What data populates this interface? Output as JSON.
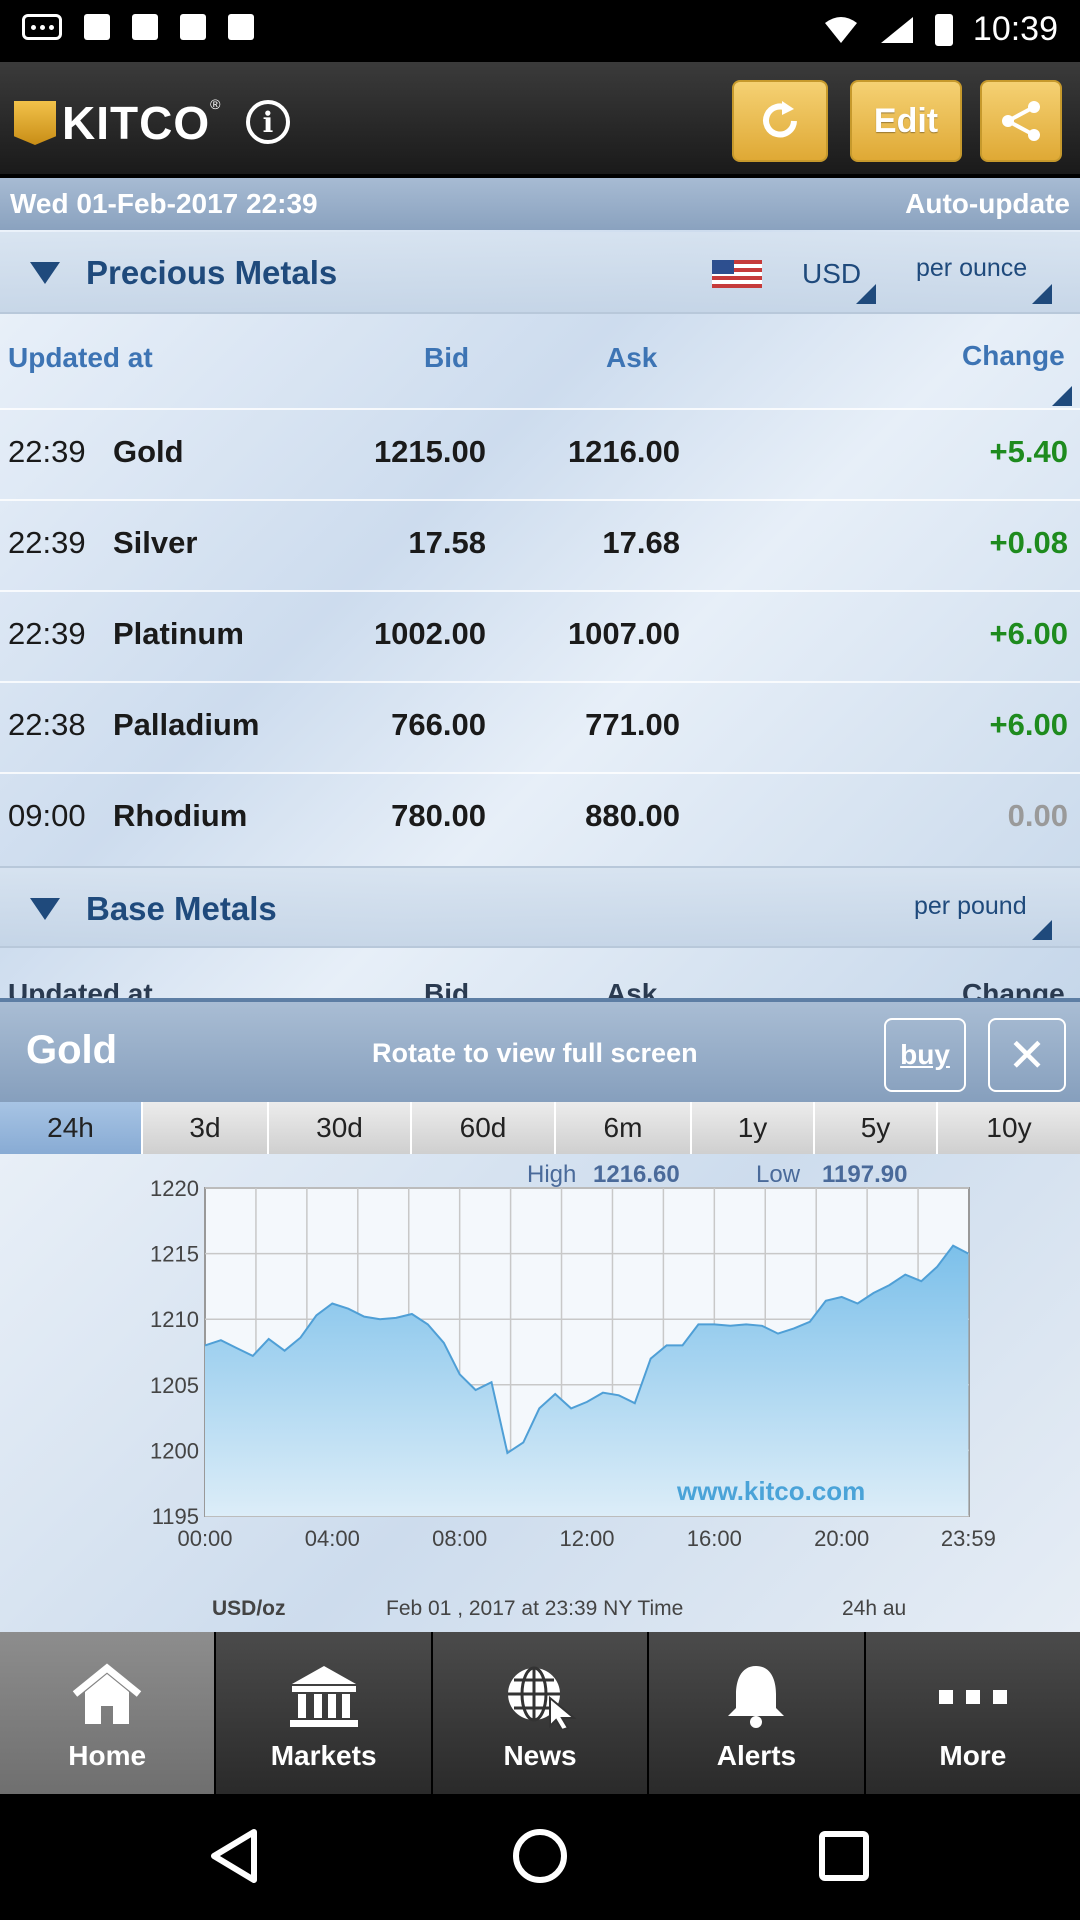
{
  "status_bar": {
    "time": "10:39"
  },
  "header": {
    "logo_text": "KITCO",
    "logo_reg": "®",
    "edit_label": "Edit"
  },
  "date_bar": {
    "date": "Wed 01-Feb-2017 22:39",
    "auto_update": "Auto-update"
  },
  "precious": {
    "title": "Precious Metals",
    "currency": "USD",
    "unit": "per ounce",
    "columns": {
      "updated": "Updated at",
      "bid": "Bid",
      "ask": "Ask",
      "change": "Change"
    },
    "rows": [
      {
        "time": "22:39",
        "name": "Gold",
        "bid": "1215.00",
        "ask": "1216.00",
        "change": "+5.40"
      },
      {
        "time": "22:39",
        "name": "Silver",
        "bid": "17.58",
        "ask": "17.68",
        "change": "+0.08"
      },
      {
        "time": "22:39",
        "name": "Platinum",
        "bid": "1002.00",
        "ask": "1007.00",
        "change": "+6.00"
      },
      {
        "time": "22:38",
        "name": "Palladium",
        "bid": "766.00",
        "ask": "771.00",
        "change": "+6.00"
      },
      {
        "time": "09:00",
        "name": "Rhodium",
        "bid": "780.00",
        "ask": "880.00",
        "change": "0.00"
      }
    ]
  },
  "base": {
    "title": "Base Metals",
    "unit": "per pound",
    "columns": {
      "updated": "Updated at",
      "bid": "Bid",
      "ask": "Ask",
      "change": "Change"
    }
  },
  "chart_panel": {
    "title": "Gold",
    "rotate_hint": "Rotate to view full screen",
    "buy_label": "buy",
    "close_label": "✕",
    "tabs": [
      "24h",
      "3d",
      "30d",
      "60d",
      "6m",
      "1y",
      "5y",
      "10y"
    ],
    "active_tab": "24h"
  },
  "chart_data": {
    "type": "area",
    "high_label": "High",
    "high_value": "1216.60",
    "low_label": "Low",
    "low_value": "1197.90",
    "watermark": "www.kitco.com",
    "unit_label": "USD/oz",
    "footnote": "Feb 01 , 2017 at 23:39 NY Time",
    "range_label": "24h au",
    "ylim": [
      1195,
      1220
    ],
    "yticks": [
      1220,
      1215,
      1210,
      1205,
      1200,
      1195
    ],
    "xticks": [
      "00:00",
      "04:00",
      "08:00",
      "12:00",
      "16:00",
      "20:00",
      "23:59"
    ],
    "x_hours": [
      0,
      0.5,
      1,
      1.5,
      2,
      2.5,
      3,
      3.5,
      4,
      4.5,
      5,
      5.5,
      6,
      6.5,
      7,
      7.5,
      8,
      8.5,
      9,
      9.5,
      10,
      10.5,
      11,
      11.5,
      12,
      12.5,
      13,
      13.5,
      14,
      14.5,
      15,
      15.5,
      16,
      16.5,
      17,
      17.5,
      18,
      18.5,
      19,
      19.5,
      20,
      20.5,
      21,
      21.5,
      22,
      22.5,
      23,
      23.5,
      23.98
    ],
    "values": [
      1208.0,
      1208.4,
      1207.8,
      1207.2,
      1208.5,
      1207.6,
      1208.6,
      1210.3,
      1211.2,
      1210.8,
      1210.2,
      1210.0,
      1210.1,
      1210.4,
      1209.6,
      1208.2,
      1205.8,
      1204.6,
      1205.2,
      1199.8,
      1200.6,
      1203.2,
      1204.3,
      1203.2,
      1203.7,
      1204.4,
      1204.2,
      1203.6,
      1207.0,
      1208.0,
      1208.0,
      1209.6,
      1209.6,
      1209.5,
      1209.6,
      1209.5,
      1208.9,
      1209.3,
      1209.8,
      1211.4,
      1211.7,
      1211.2,
      1212.0,
      1212.6,
      1213.4,
      1212.9,
      1214.0,
      1215.6,
      1215.0
    ]
  },
  "bottom_nav": {
    "items": [
      "Home",
      "Markets",
      "News",
      "Alerts",
      "More"
    ],
    "active": "Home"
  }
}
